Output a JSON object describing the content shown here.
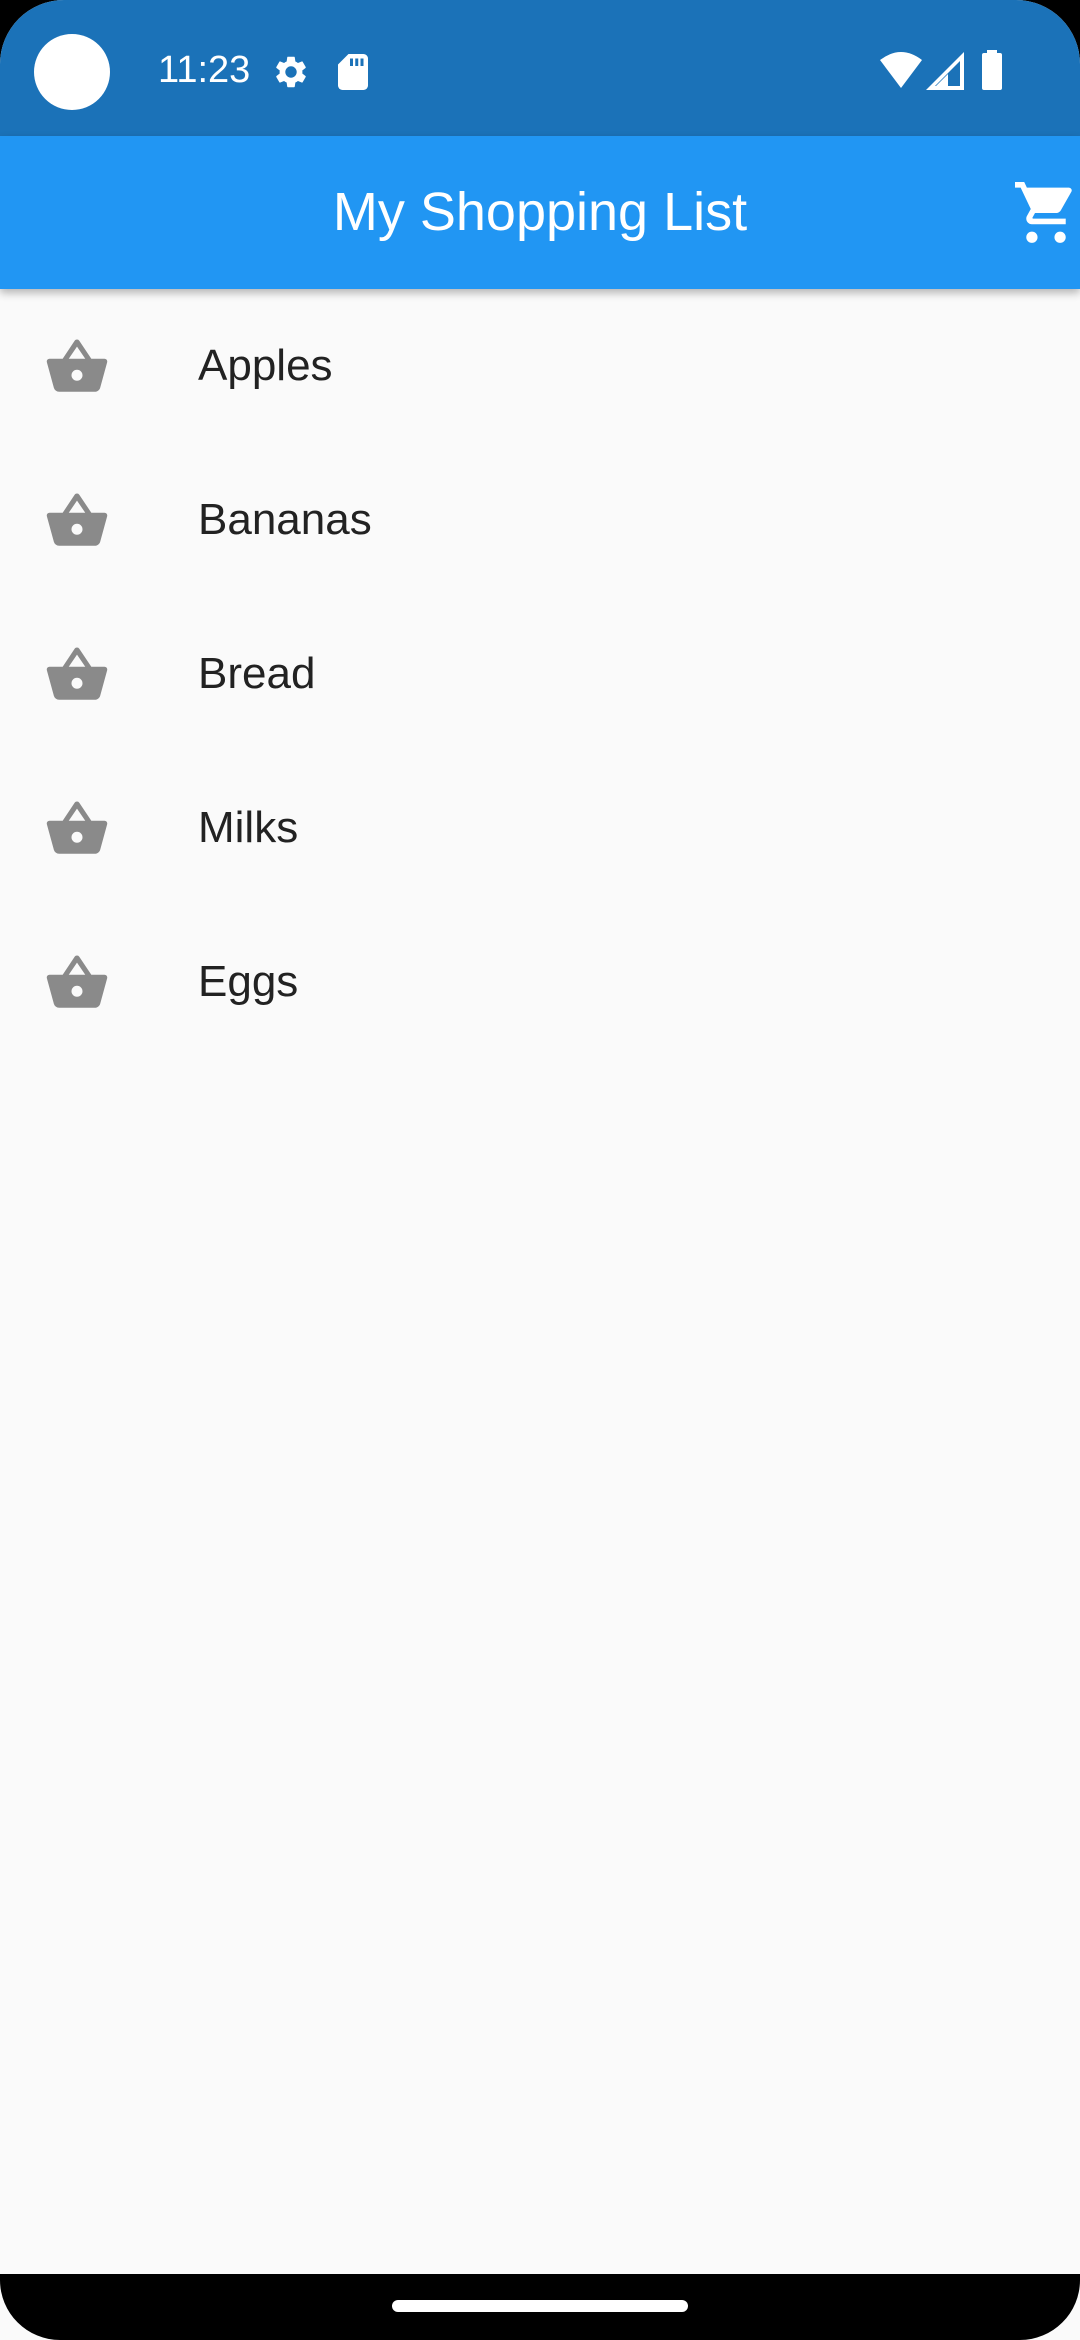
{
  "status_bar": {
    "time": "11:23",
    "icons": [
      "camera-cutout",
      "settings-gear-icon",
      "sd-card-icon",
      "wifi-icon",
      "cell-signal-icon",
      "battery-icon"
    ]
  },
  "app_bar": {
    "title": "My Shopping List",
    "action_icon": "shopping-cart-icon"
  },
  "list": {
    "item_icon": "shopping-basket-icon",
    "items": [
      {
        "label": "Apples"
      },
      {
        "label": "Bananas"
      },
      {
        "label": "Bread"
      },
      {
        "label": "Milks"
      },
      {
        "label": "Eggs"
      }
    ]
  },
  "colors": {
    "status_bar": "#1b72b8",
    "app_bar": "#2196f3",
    "background": "#fafafa",
    "icon_gray": "#8a8a8a",
    "text": "#222222"
  }
}
